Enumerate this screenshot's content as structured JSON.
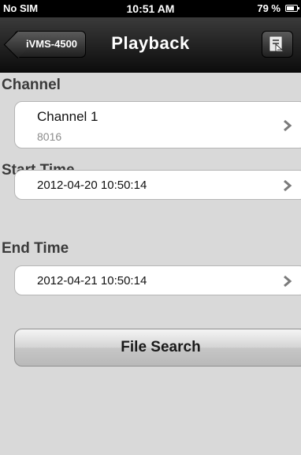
{
  "status_bar": {
    "carrier": "No SIM",
    "time": "10:51 AM",
    "battery": "79 %",
    "battery_level": 0.79
  },
  "nav_bar": {
    "back_label": "iVMS-4500",
    "title": "Playback",
    "right_icon": "playback-list-icon"
  },
  "channel": {
    "header": "Channel",
    "name": "Channel 1",
    "id": "8016"
  },
  "start_time": {
    "header": "Start Time",
    "value": "2012-04-20 10:50:14"
  },
  "end_time": {
    "header": "End Time",
    "value": "2012-04-21 10:50:14"
  },
  "actions": {
    "file_search_label": "File Search"
  }
}
